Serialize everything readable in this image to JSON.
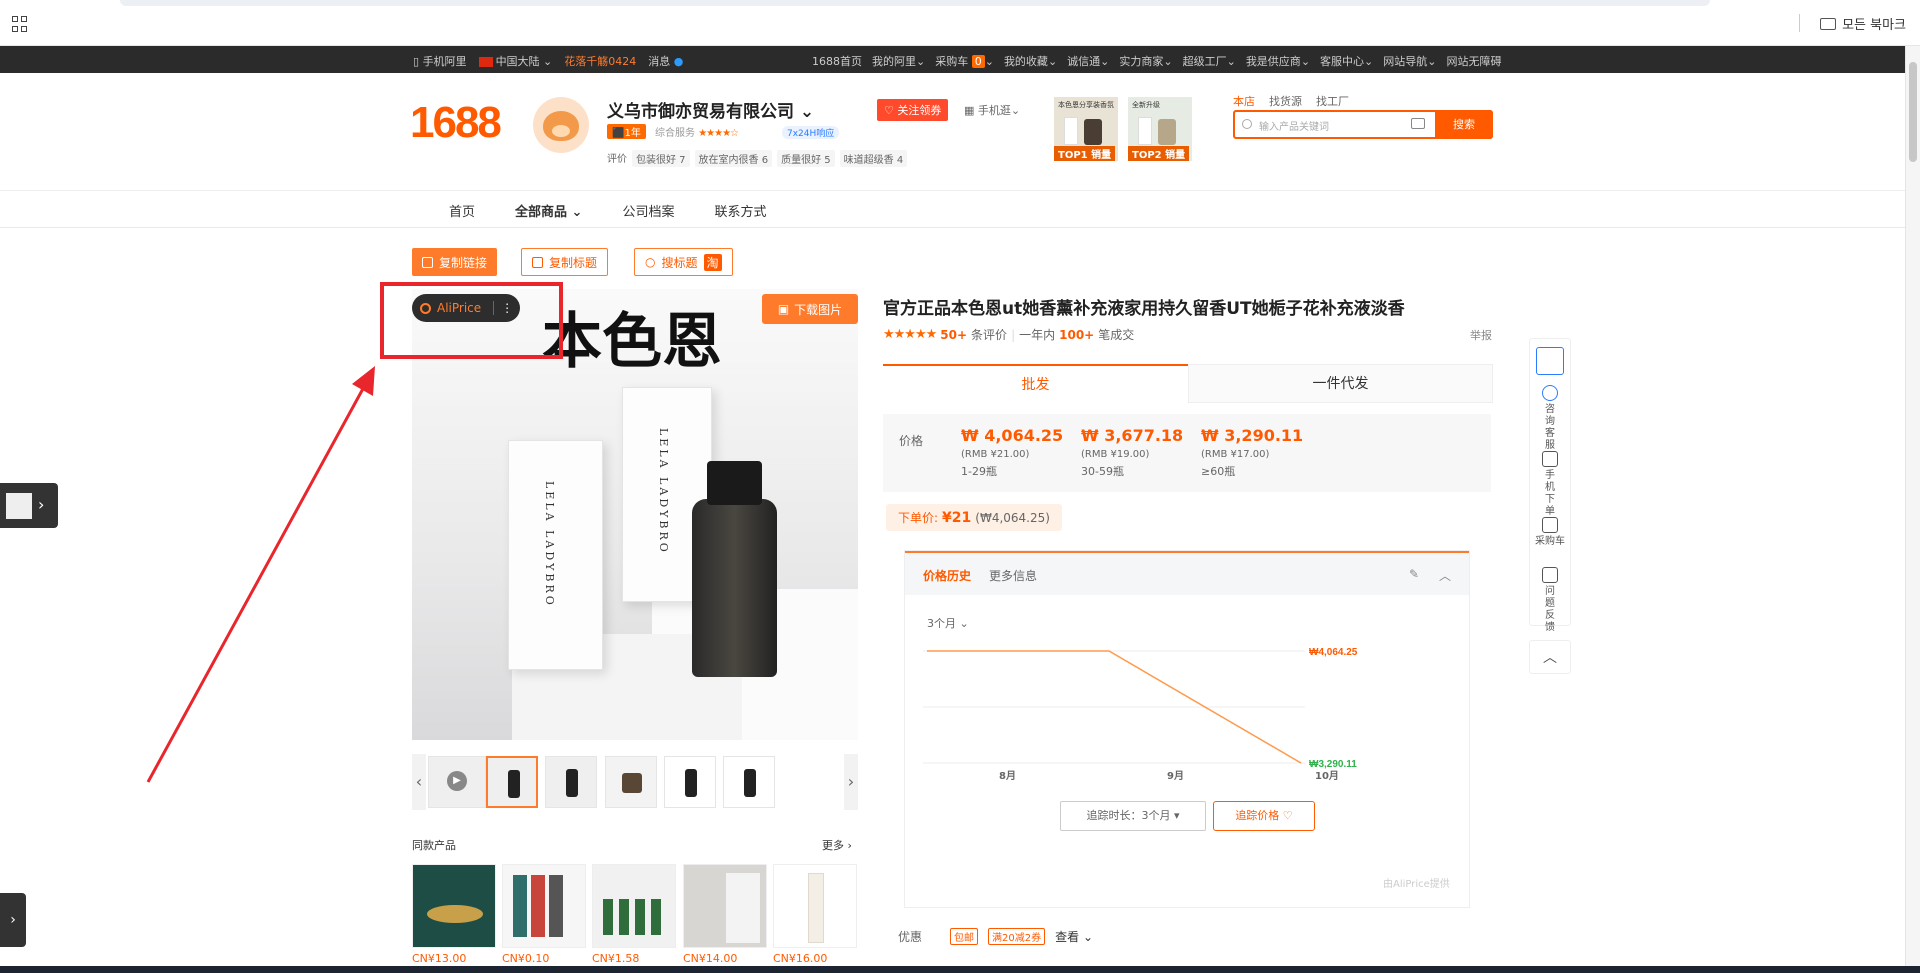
{
  "browser": {
    "bookmarks_label": "모든 북마크"
  },
  "topbar": {
    "mobile": "手机阿里",
    "region": "中国大陆",
    "promo": "花落千觞0424",
    "messages": "消息",
    "links": [
      "1688首页",
      "我的阿里",
      "采购车",
      "我的收藏",
      "诚信通",
      "实力商家",
      "超级工厂",
      "我是供应商",
      "客服中心",
      "网站导航",
      "网站无障碍"
    ],
    "cart_count": "0"
  },
  "header": {
    "logo": "1688",
    "company": "义乌市御亦贸易有限公司",
    "years": "1年",
    "service_label": "综合服务",
    "stars": "★★★★☆",
    "badge": "7x24H响应",
    "evals_label": "评价",
    "evals": [
      "包装很好 7",
      "放在室内很香 6",
      "质量很好 5",
      "味道超级香 4"
    ],
    "follow": "关注领券",
    "mobile_shop": "手机逛",
    "tiles": [
      {
        "text": "本色恩分享装香氛",
        "cap": "TOP1 销量"
      },
      {
        "text": "全新升级",
        "cap": "TOP2 销量"
      }
    ],
    "search_tabs": [
      "本店",
      "找货源",
      "找工厂"
    ],
    "search_placeholder": "输入产品关键词",
    "search_button": "搜索"
  },
  "nav": {
    "items": [
      "首页",
      "全部商品",
      "公司档案",
      "联系方式"
    ]
  },
  "actions": {
    "copy_link": "复制链接",
    "copy_title": "复制标题",
    "search_title": "搜标题",
    "taobao": "淘"
  },
  "gallery": {
    "aliprice": "AliPrice",
    "download": "下载图片",
    "brand_text": "本色恩",
    "box_text": "LELA LADYBRO",
    "same_products": "同款产品",
    "more": "更多",
    "prices": [
      "CN¥13.00",
      "CN¥0.10",
      "CN¥1.58",
      "CN¥14.00",
      "CN¥16.00"
    ]
  },
  "product": {
    "title": "官方正品本色恩ut她香薰补充液家用持久留香UT她栀子花补充液淡香",
    "rating_stars": "★★★★★",
    "reviews_count": "50+",
    "reviews_label": "条评价",
    "sold_label": "一年内",
    "sold_count": "100+",
    "sold_suffix": "笔成交",
    "report": "举报",
    "tab_wholesale": "批发",
    "tab_dropship": "一件代发",
    "price_label": "价格",
    "tiers": [
      {
        "krw": "₩ 4,064.25",
        "rmb": "(RMB ¥21.00)",
        "qty": "1-29瓶"
      },
      {
        "krw": "₩ 3,677.18",
        "rmb": "(RMB ¥19.00)",
        "qty": "30-59瓶"
      },
      {
        "krw": "₩ 3,290.11",
        "rmb": "(RMB ¥17.00)",
        "qty": "≥60瓶"
      }
    ],
    "unit_label": "下单价:",
    "unit_price": "¥21",
    "unit_krw": "(₩4,064.25)",
    "promo_label": "优惠",
    "promo_tags": [
      "包邮",
      "满20减2券"
    ],
    "promo_view": "查看"
  },
  "history": {
    "tab_active": "价格历史",
    "tab_other": "更多信息",
    "range": "3个月",
    "track_duration": "追踪时长：3个月",
    "track_button": "追踪价格",
    "powered": "由AliPrice提供"
  },
  "chart_data": {
    "type": "line",
    "x": [
      "8月",
      "9月",
      "10月"
    ],
    "series": [
      {
        "values": [
          4064.25,
          4064.25,
          4064.25,
          3290.11
        ]
      }
    ],
    "max_label": "₩4,064.25",
    "min_label": "₩3,290.11",
    "color": "#ff9a4d"
  },
  "sidebar": {
    "items": [
      "咨询客服",
      "手机下单",
      "采购车",
      "问题反馈"
    ]
  },
  "colors": {
    "accent": "#ff5a00",
    "annotation": "#e8262c"
  }
}
